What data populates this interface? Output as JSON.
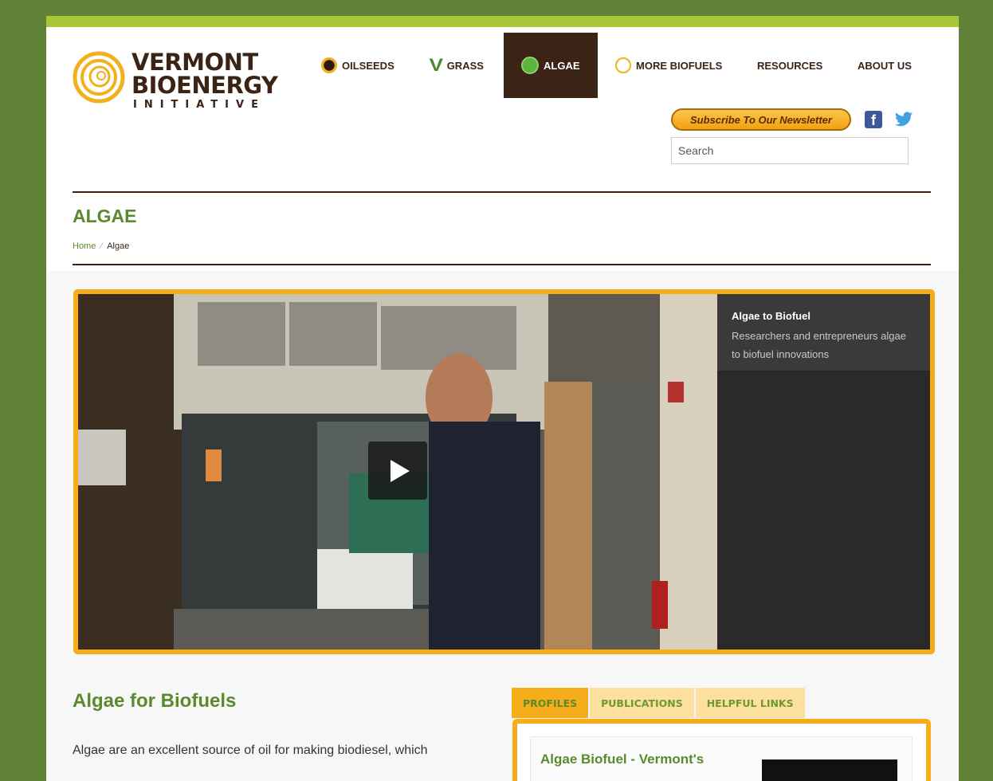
{
  "logo": {
    "line1": "VERMONT",
    "line2": "BIOENERGY",
    "line3": "INITIATIVE"
  },
  "nav": {
    "items": [
      {
        "label": "OILSEEDS",
        "icon": "sunflower-icon"
      },
      {
        "label": "GRASS",
        "icon": "grass-icon"
      },
      {
        "label": "ALGAE",
        "icon": "algae-dot-icon",
        "active": true
      },
      {
        "label": "MORE BIOFUELS",
        "icon": "sun-swirl-icon"
      },
      {
        "label": "RESOURCES"
      },
      {
        "label": "ABOUT US"
      }
    ]
  },
  "header": {
    "subscribe_label": "Subscribe To Our Newsletter",
    "search_placeholder": "Search"
  },
  "page": {
    "title": "ALGAE",
    "breadcrumb": {
      "home": "Home",
      "current": "Algae"
    }
  },
  "video": {
    "title": "Algae to Biofuel",
    "description": "Researchers and entrepreneurs algae to biofuel innovations"
  },
  "article": {
    "heading": "Algae for Biofuels",
    "intro": "Algae are an excellent source of oil for making biodiesel, which"
  },
  "tabs": {
    "items": [
      "PROFILES",
      "PUBLICATIONS",
      "HELPFUL LINKS"
    ],
    "active_index": 0
  },
  "profile": {
    "title": "Algae Biofuel - Vermont's"
  },
  "colors": {
    "frame_green": "#5f8237",
    "accent_lime": "#a8c63a",
    "brown": "#3b2315",
    "orange": "#f6ad19",
    "heading_green": "#5b8a2e"
  }
}
